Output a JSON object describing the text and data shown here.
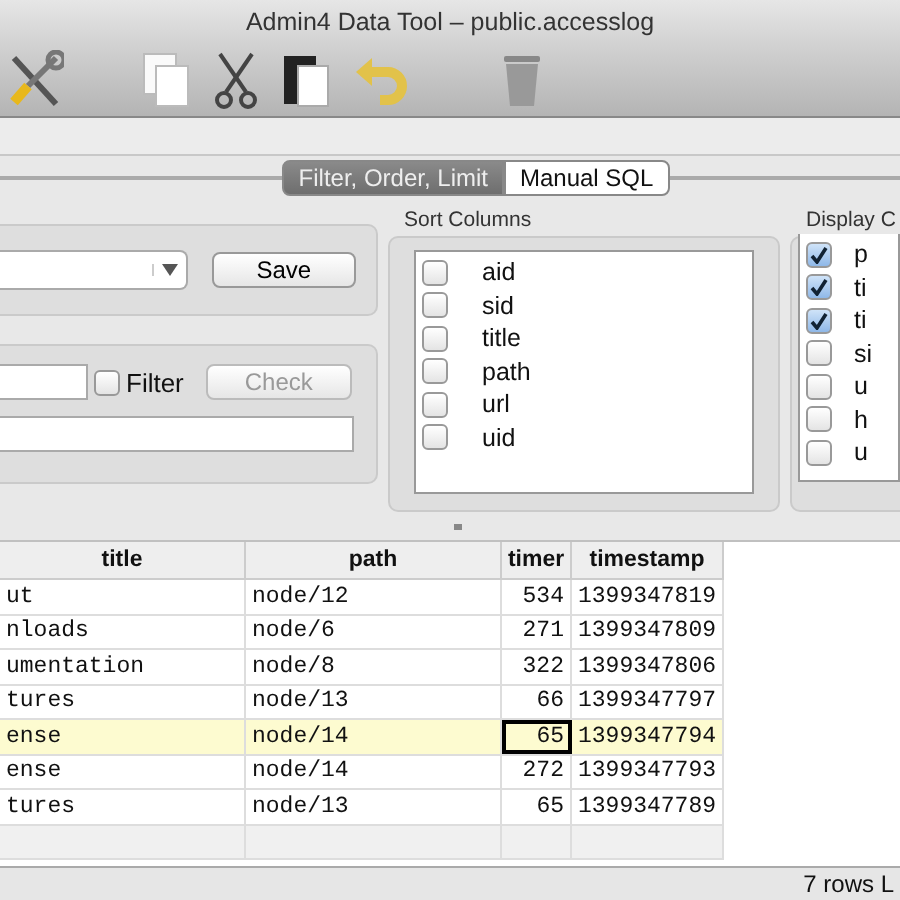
{
  "window": {
    "title": "Admin4 Data Tool – public.accesslog"
  },
  "tabs": [
    {
      "label": "Filter, Order, Limit",
      "selected": true
    },
    {
      "label": "Manual SQL",
      "selected": false
    }
  ],
  "query_panel": {
    "save_button": "Save"
  },
  "filter_panel": {
    "filter_checkbox": {
      "label": "Filter",
      "checked": false
    },
    "check_button": {
      "label": "Check",
      "disabled": true
    }
  },
  "sort_columns": {
    "title": "Sort Columns",
    "items": [
      {
        "label": "aid",
        "checked": false
      },
      {
        "label": "sid",
        "checked": false
      },
      {
        "label": "title",
        "checked": false
      },
      {
        "label": "path",
        "checked": false
      },
      {
        "label": "url",
        "checked": false
      },
      {
        "label": "uid",
        "checked": false
      }
    ]
  },
  "display_columns": {
    "title": "Display C",
    "items": [
      {
        "label": "p",
        "checked": true
      },
      {
        "label": "ti",
        "checked": true
      },
      {
        "label": "ti",
        "checked": true
      },
      {
        "label": "si",
        "checked": false
      },
      {
        "label": "u",
        "checked": false
      },
      {
        "label": "h",
        "checked": false
      },
      {
        "label": "u",
        "checked": false
      }
    ]
  },
  "table": {
    "columns": [
      "title",
      "path",
      "timer",
      "timestamp"
    ],
    "rows": [
      {
        "cells": [
          "ut",
          "node/12",
          "534",
          "1399347819"
        ],
        "selected": false
      },
      {
        "cells": [
          "nloads",
          "node/6",
          "271",
          "1399347809"
        ],
        "selected": false
      },
      {
        "cells": [
          "umentation",
          "node/8",
          "322",
          "1399347806"
        ],
        "selected": false
      },
      {
        "cells": [
          "tures",
          "node/13",
          "66",
          "1399347797"
        ],
        "selected": false
      },
      {
        "cells": [
          "ense",
          "node/14",
          "65",
          "1399347794"
        ],
        "selected": true
      },
      {
        "cells": [
          "ense",
          "node/14",
          "272",
          "1399347793"
        ],
        "selected": false
      },
      {
        "cells": [
          "tures",
          "node/13",
          "65",
          "1399347789"
        ],
        "selected": false
      }
    ]
  },
  "status_bar": {
    "text": "7 rows L"
  }
}
